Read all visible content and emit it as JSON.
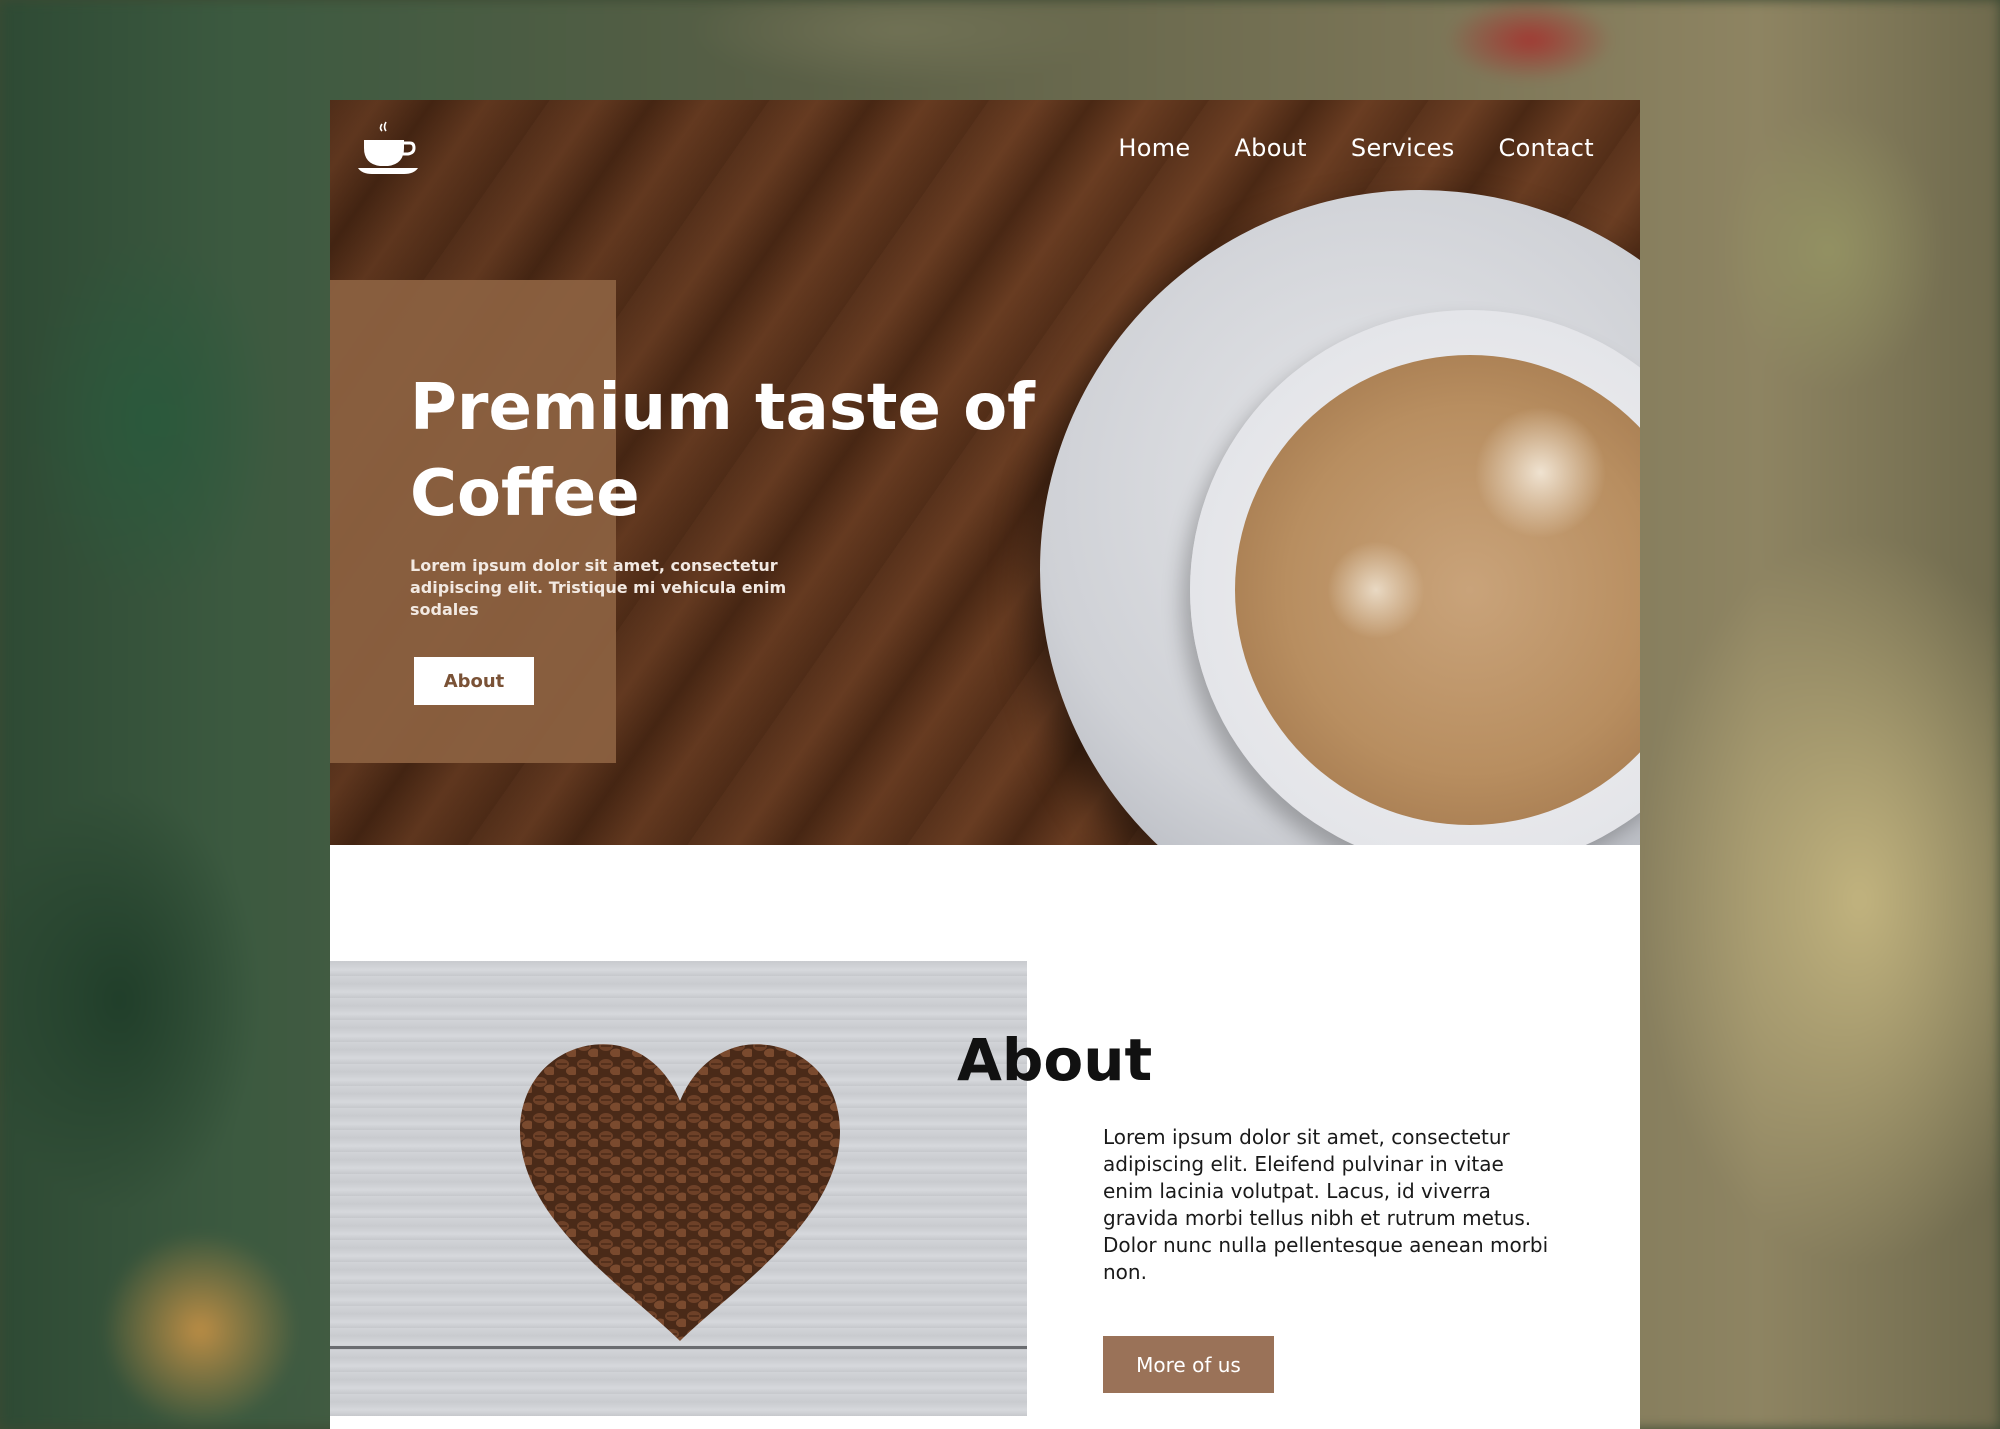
{
  "nav": {
    "items": [
      {
        "label": "Home"
      },
      {
        "label": "About"
      },
      {
        "label": "Services"
      },
      {
        "label": "Contact"
      }
    ]
  },
  "logo": {
    "icon": "coffee-cup-icon"
  },
  "hero": {
    "title": "Premium taste of Coffee",
    "text": "Lorem ipsum dolor sit amet, consectetur adipiscing elit. Tristique mi vehicula enim sodales",
    "button_label": "About"
  },
  "about": {
    "title": "About",
    "text": "Lorem ipsum dolor sit amet, consectetur adipiscing elit. Eleifend pulvinar in vitae enim lacinia volutpat. Lacus, id viverra gravida morbi tellus nibh et rutrum metus. Dolor nunc nulla pellentesque aenean morbi non.",
    "button_label": "More of us"
  },
  "colors": {
    "accent_brown": "#8a6040",
    "button_brown": "#9a7258",
    "white": "#ffffff"
  }
}
